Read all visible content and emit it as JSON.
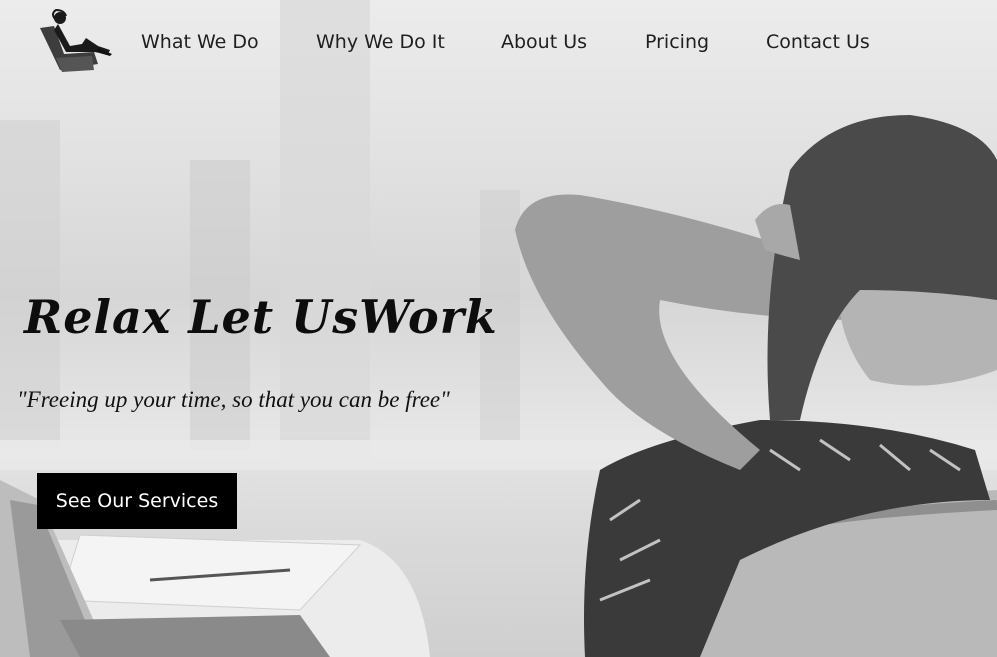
{
  "nav": {
    "items": [
      {
        "label": "What We Do"
      },
      {
        "label": "Why We Do It"
      },
      {
        "label": "About Us"
      },
      {
        "label": "Pricing"
      },
      {
        "label": "Contact Us"
      }
    ]
  },
  "logo": {
    "icon": "relaxing-person-in-chair-icon"
  },
  "hero": {
    "headline": "Relax Let UsWork",
    "tagline": "\"Freeing up your time, so that you can be free\"",
    "cta_label": "See Our Services",
    "image": "woman-relaxing-in-office-chair-photo"
  },
  "colors": {
    "text": "#1f1f1f",
    "cta_bg": "#000000",
    "cta_text": "#ffffff"
  }
}
